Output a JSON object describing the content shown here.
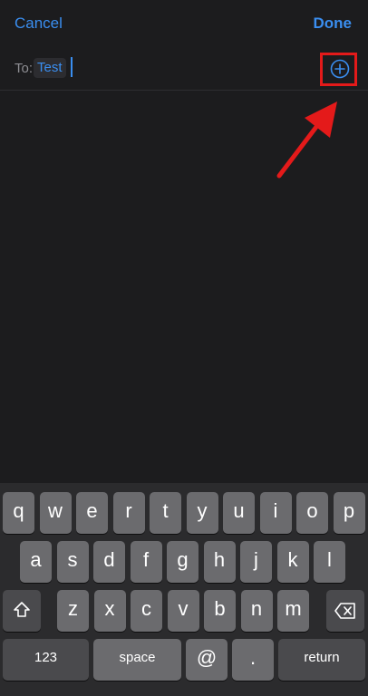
{
  "nav": {
    "cancel_label": "Cancel",
    "done_label": "Done"
  },
  "compose": {
    "to_label": "To:",
    "recipient": "Test",
    "add_icon": "plus-circle-icon"
  },
  "annotation": {
    "highlight_color": "#e41a1a",
    "arrow_icon": "arrow-icon"
  },
  "keyboard": {
    "row1": [
      "q",
      "w",
      "e",
      "r",
      "t",
      "y",
      "u",
      "i",
      "o",
      "p"
    ],
    "row2": [
      "a",
      "s",
      "d",
      "f",
      "g",
      "h",
      "j",
      "k",
      "l"
    ],
    "row3": [
      "z",
      "x",
      "c",
      "v",
      "b",
      "n",
      "m"
    ],
    "shift_icon": "shift-icon",
    "delete_icon": "backspace-icon",
    "numbers_label": "123",
    "space_label": "space",
    "at_label": "@",
    "period_label": ".",
    "return_label": "return"
  },
  "colors": {
    "accent": "#3a8ef0",
    "background": "#1c1c1e",
    "key": "#6b6b6e",
    "key_dark": "#4a4a4d"
  }
}
